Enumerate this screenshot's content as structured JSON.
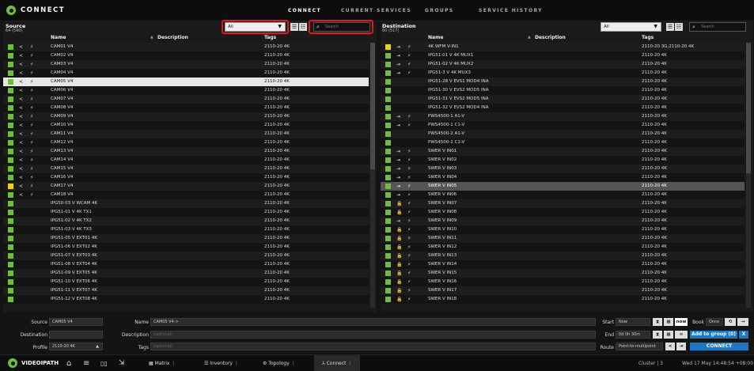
{
  "app": {
    "title": "CONNECT",
    "brand": "VIDEOIPATH"
  },
  "nav": {
    "tabs": [
      "CONNECT",
      "CURRENT SERVICES",
      "GROUPS",
      "SERVICE HISTORY"
    ]
  },
  "source": {
    "title": "Source",
    "count": "64 (590)",
    "filter": "All",
    "search_placeholder": "Search",
    "headers": {
      "name": "Name",
      "description": "Description",
      "tags": "Tags"
    },
    "rows": [
      {
        "color": "green",
        "name": "CAM01 V4",
        "tags": "2110-20 4K",
        "icons": true
      },
      {
        "color": "green",
        "name": "CAM02 V4",
        "tags": "2110-20 4K",
        "icons": true
      },
      {
        "color": "green",
        "name": "CAM03 V4",
        "tags": "2110-20 4K",
        "icons": true
      },
      {
        "color": "green",
        "name": "CAM04 V4",
        "tags": "2110-20 4K",
        "icons": true
      },
      {
        "color": "green",
        "name": "CAM05 V4",
        "tags": "2110-20 4K",
        "icons": true,
        "selected": true
      },
      {
        "color": "green",
        "name": "CAM06 V4",
        "tags": "2110-20 4K",
        "icons": true
      },
      {
        "color": "green",
        "name": "CAM07 V4",
        "tags": "2110-20 4K",
        "icons": true
      },
      {
        "color": "green",
        "name": "CAM08 V4",
        "tags": "2110-20 4K",
        "icons": true
      },
      {
        "color": "green",
        "name": "CAM09 V4",
        "tags": "2110-20 4K",
        "icons": true
      },
      {
        "color": "green",
        "name": "CAM10 V4",
        "tags": "2110-20 4K",
        "icons": true
      },
      {
        "color": "green",
        "name": "CAM11 V4",
        "tags": "2110-20 4K",
        "icons": true
      },
      {
        "color": "green",
        "name": "CAM12 V4",
        "tags": "2110-20 4K",
        "icons": true
      },
      {
        "color": "green",
        "name": "CAM13 V4",
        "tags": "2110-20 4K",
        "icons": true
      },
      {
        "color": "green",
        "name": "CAM14 V4",
        "tags": "2110-20 4K",
        "icons": true
      },
      {
        "color": "green",
        "name": "CAM15 V4",
        "tags": "2110-20 4K",
        "icons": true
      },
      {
        "color": "green",
        "name": "CAM16 V4",
        "tags": "2110-20 4K",
        "icons": true
      },
      {
        "color": "yellow",
        "name": "CAM17 V4",
        "tags": "2110-20 4K",
        "icons": true
      },
      {
        "color": "green",
        "name": "CAM18 V4",
        "tags": "2110-20 4K",
        "icons": true
      },
      {
        "color": "green",
        "name": "IPG50-03 V WCAM 4K",
        "tags": "2110-20 4K",
        "icons": false
      },
      {
        "color": "green",
        "name": "IPG51-01 V 4K TX1",
        "tags": "2110-20 4K",
        "icons": false
      },
      {
        "color": "green",
        "name": "IPG51-02 V 4K TX2",
        "tags": "2110-20 4K",
        "icons": false
      },
      {
        "color": "green",
        "name": "IPG51-03 V 4K TX3",
        "tags": "2110-20 4K",
        "icons": false
      },
      {
        "color": "green",
        "name": "IPG51-05 V EXT01 4K",
        "tags": "2110-20 4K",
        "icons": false
      },
      {
        "color": "green",
        "name": "IPG51-06 V EXT02 4K",
        "tags": "2110-20 4K",
        "icons": false
      },
      {
        "color": "green",
        "name": "IPG51-07 V EXT03 4K",
        "tags": "2110-20 4K",
        "icons": false
      },
      {
        "color": "green",
        "name": "IPG51-08 V EXT04 4K",
        "tags": "2110-20 4K",
        "icons": false
      },
      {
        "color": "green",
        "name": "IPG51-09 V EXT05 4K",
        "tags": "2110-20 4K",
        "icons": false
      },
      {
        "color": "green",
        "name": "IPG51-10 V EXT06 4K",
        "tags": "2110-20 4K",
        "icons": false
      },
      {
        "color": "green",
        "name": "IPG51-11 V EXT07 4K",
        "tags": "2110-20 4K",
        "icons": false
      },
      {
        "color": "green",
        "name": "IPG51-12 V EXT08 4K",
        "tags": "2110-20 4K",
        "icons": false
      }
    ]
  },
  "destination": {
    "title": "Destination",
    "count": "60 (517)",
    "filter": "All",
    "search_placeholder": "Search",
    "headers": {
      "name": "Name",
      "description": "Description",
      "tags": "Tags"
    },
    "rows": [
      {
        "color": "yellow",
        "name": "4K WFM V-IN1",
        "tags": "2110-20 3G,2110-20 4K",
        "icons": "io"
      },
      {
        "color": "green",
        "name": "IPG51-01 V 4K MUX1",
        "tags": "2110-20 4K",
        "icons": "io"
      },
      {
        "color": "green",
        "name": "IPG51-02 V 4K MUX2",
        "tags": "2110-20 4K",
        "icons": "io"
      },
      {
        "color": "green",
        "name": "IPG51-3 V 4K MUX3",
        "tags": "2110-20 4K",
        "icons": "io"
      },
      {
        "color": "green",
        "name": "IPG51-28 V EVS1 MOD4 INA",
        "tags": "2110-20 4K",
        "icons": ""
      },
      {
        "color": "green",
        "name": "IPG51-30 V EVS2 MOD5 INA",
        "tags": "2110-20 4K",
        "icons": ""
      },
      {
        "color": "green",
        "name": "IPG51-31 V EVS2 MOD5 INA",
        "tags": "2110-20 4K",
        "icons": ""
      },
      {
        "color": "green",
        "name": "IPG51-32 V EVS2 MOD4 INA",
        "tags": "2110-20 4K",
        "icons": ""
      },
      {
        "color": "green",
        "name": "PWS4500-1 A1-V",
        "tags": "2110-20 4K",
        "icons": "io"
      },
      {
        "color": "green",
        "name": "PWS4500-1 C1-V",
        "tags": "2110-20 4K",
        "icons": "io"
      },
      {
        "color": "green",
        "name": "PWS4500-2 A1-V",
        "tags": "2110-20 4K",
        "icons": ""
      },
      {
        "color": "green",
        "name": "PWS4500-2 C1-V",
        "tags": "2110-20 4K",
        "icons": ""
      },
      {
        "color": "green",
        "name": "SWER V IN01",
        "tags": "2110-20 4K",
        "icons": "io"
      },
      {
        "color": "green",
        "name": "SWER V IN02",
        "tags": "2110-20 4K",
        "icons": "io"
      },
      {
        "color": "green",
        "name": "SWER V IN03",
        "tags": "2110-20 4K",
        "icons": "io"
      },
      {
        "color": "green",
        "name": "SWER V IN04",
        "tags": "2110-20 4K",
        "icons": "io"
      },
      {
        "color": "green",
        "name": "SWER V IN05",
        "tags": "2110-20 4K",
        "icons": "io",
        "selected": true
      },
      {
        "color": "green",
        "name": "SWER V IN06",
        "tags": "2110-20 4K",
        "icons": "io"
      },
      {
        "color": "green",
        "name": "SWER V IN07",
        "tags": "2110-20 4K",
        "icons": "lock"
      },
      {
        "color": "green",
        "name": "SWER V IN08",
        "tags": "2110-20 4K",
        "icons": "lock"
      },
      {
        "color": "green",
        "name": "SWER V IN09",
        "tags": "2110-20 4K",
        "icons": "io"
      },
      {
        "color": "green",
        "name": "SWER V IN10",
        "tags": "2110-20 4K",
        "icons": "lock"
      },
      {
        "color": "green",
        "name": "SWER V IN11",
        "tags": "2110-20 4K",
        "icons": "lock"
      },
      {
        "color": "green",
        "name": "SWER V IN12",
        "tags": "2110-20 4K",
        "icons": "lock"
      },
      {
        "color": "green",
        "name": "SWER V IN13",
        "tags": "2110-20 4K",
        "icons": "lock"
      },
      {
        "color": "green",
        "name": "SWER V IN14",
        "tags": "2110-20 4K",
        "icons": "lock"
      },
      {
        "color": "green",
        "name": "SWER V IN15",
        "tags": "2110-20 4K",
        "icons": "lock"
      },
      {
        "color": "green",
        "name": "SWER V IN16",
        "tags": "2110-20 4K",
        "icons": "lock"
      },
      {
        "color": "green",
        "name": "SWER V IN17",
        "tags": "2110-20 4K",
        "icons": "lock"
      },
      {
        "color": "green",
        "name": "SWER V IN18",
        "tags": "2110-20 4K",
        "icons": "lock"
      }
    ]
  },
  "form": {
    "source_label": "Source",
    "source_value": "CAM05 V4",
    "destination_label": "Destination",
    "profile_label": "Profile",
    "profile_value": "2110-20 4K",
    "name_label": "Name",
    "name_value": "CAM05 V4->",
    "description_label": "Description",
    "description_placeholder": "(optional)",
    "tags_label": "Tags",
    "tags_placeholder": "(optional)",
    "start_label": "Start",
    "start_value": "Now",
    "now_button": "now",
    "end_label": "End",
    "end_value": "0d 0h 30m",
    "route_label": "Route",
    "route_value": "Point-to-multipoint",
    "book_label": "Book",
    "book_value": "Once",
    "add_group_button": "Add to group (0)",
    "close_x": "X",
    "connect_button": "CONNECT"
  },
  "footer": {
    "tabs": [
      "Matrix",
      "Inventory",
      "Topology",
      "Connect"
    ],
    "cluster": "Cluster | 3",
    "datetime": "Wed 17 May   14:48:54 +08:00"
  },
  "colors": {
    "green": "#6dbf3a",
    "yellow": "#f2d20a",
    "accent": "#1b78c7",
    "highlight": "#e4171d"
  }
}
